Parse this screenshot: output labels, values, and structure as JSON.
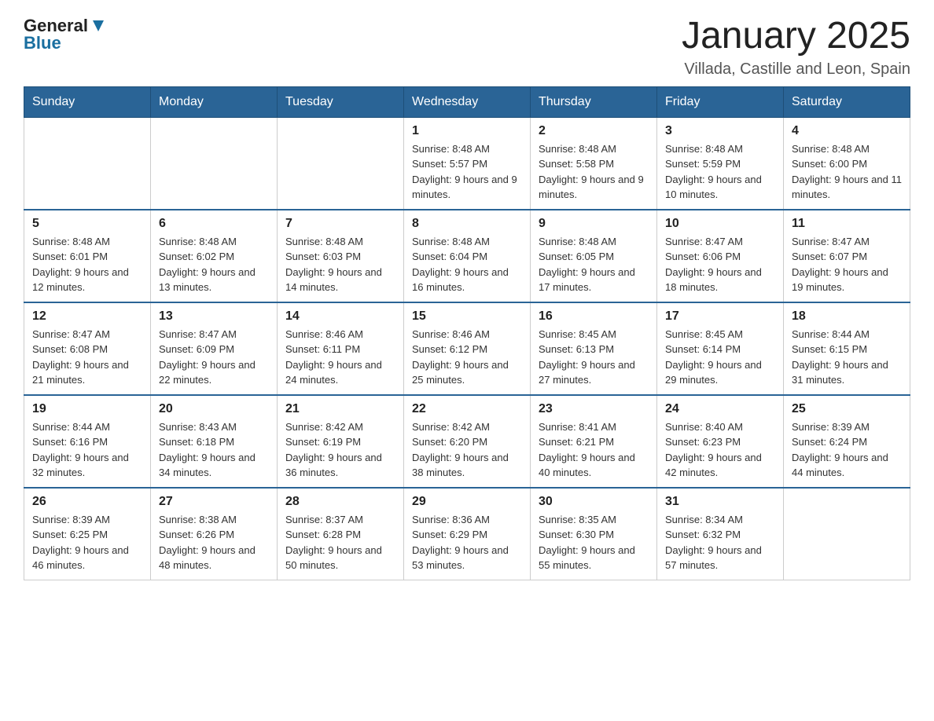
{
  "header": {
    "logo_general": "General",
    "logo_blue": "Blue",
    "title": "January 2025",
    "subtitle": "Villada, Castille and Leon, Spain"
  },
  "weekdays": [
    "Sunday",
    "Monday",
    "Tuesday",
    "Wednesday",
    "Thursday",
    "Friday",
    "Saturday"
  ],
  "weeks": [
    [
      {
        "day": "",
        "info": ""
      },
      {
        "day": "",
        "info": ""
      },
      {
        "day": "",
        "info": ""
      },
      {
        "day": "1",
        "info": "Sunrise: 8:48 AM\nSunset: 5:57 PM\nDaylight: 9 hours and 9 minutes."
      },
      {
        "day": "2",
        "info": "Sunrise: 8:48 AM\nSunset: 5:58 PM\nDaylight: 9 hours and 9 minutes."
      },
      {
        "day": "3",
        "info": "Sunrise: 8:48 AM\nSunset: 5:59 PM\nDaylight: 9 hours and 10 minutes."
      },
      {
        "day": "4",
        "info": "Sunrise: 8:48 AM\nSunset: 6:00 PM\nDaylight: 9 hours and 11 minutes."
      }
    ],
    [
      {
        "day": "5",
        "info": "Sunrise: 8:48 AM\nSunset: 6:01 PM\nDaylight: 9 hours and 12 minutes."
      },
      {
        "day": "6",
        "info": "Sunrise: 8:48 AM\nSunset: 6:02 PM\nDaylight: 9 hours and 13 minutes."
      },
      {
        "day": "7",
        "info": "Sunrise: 8:48 AM\nSunset: 6:03 PM\nDaylight: 9 hours and 14 minutes."
      },
      {
        "day": "8",
        "info": "Sunrise: 8:48 AM\nSunset: 6:04 PM\nDaylight: 9 hours and 16 minutes."
      },
      {
        "day": "9",
        "info": "Sunrise: 8:48 AM\nSunset: 6:05 PM\nDaylight: 9 hours and 17 minutes."
      },
      {
        "day": "10",
        "info": "Sunrise: 8:47 AM\nSunset: 6:06 PM\nDaylight: 9 hours and 18 minutes."
      },
      {
        "day": "11",
        "info": "Sunrise: 8:47 AM\nSunset: 6:07 PM\nDaylight: 9 hours and 19 minutes."
      }
    ],
    [
      {
        "day": "12",
        "info": "Sunrise: 8:47 AM\nSunset: 6:08 PM\nDaylight: 9 hours and 21 minutes."
      },
      {
        "day": "13",
        "info": "Sunrise: 8:47 AM\nSunset: 6:09 PM\nDaylight: 9 hours and 22 minutes."
      },
      {
        "day": "14",
        "info": "Sunrise: 8:46 AM\nSunset: 6:11 PM\nDaylight: 9 hours and 24 minutes."
      },
      {
        "day": "15",
        "info": "Sunrise: 8:46 AM\nSunset: 6:12 PM\nDaylight: 9 hours and 25 minutes."
      },
      {
        "day": "16",
        "info": "Sunrise: 8:45 AM\nSunset: 6:13 PM\nDaylight: 9 hours and 27 minutes."
      },
      {
        "day": "17",
        "info": "Sunrise: 8:45 AM\nSunset: 6:14 PM\nDaylight: 9 hours and 29 minutes."
      },
      {
        "day": "18",
        "info": "Sunrise: 8:44 AM\nSunset: 6:15 PM\nDaylight: 9 hours and 31 minutes."
      }
    ],
    [
      {
        "day": "19",
        "info": "Sunrise: 8:44 AM\nSunset: 6:16 PM\nDaylight: 9 hours and 32 minutes."
      },
      {
        "day": "20",
        "info": "Sunrise: 8:43 AM\nSunset: 6:18 PM\nDaylight: 9 hours and 34 minutes."
      },
      {
        "day": "21",
        "info": "Sunrise: 8:42 AM\nSunset: 6:19 PM\nDaylight: 9 hours and 36 minutes."
      },
      {
        "day": "22",
        "info": "Sunrise: 8:42 AM\nSunset: 6:20 PM\nDaylight: 9 hours and 38 minutes."
      },
      {
        "day": "23",
        "info": "Sunrise: 8:41 AM\nSunset: 6:21 PM\nDaylight: 9 hours and 40 minutes."
      },
      {
        "day": "24",
        "info": "Sunrise: 8:40 AM\nSunset: 6:23 PM\nDaylight: 9 hours and 42 minutes."
      },
      {
        "day": "25",
        "info": "Sunrise: 8:39 AM\nSunset: 6:24 PM\nDaylight: 9 hours and 44 minutes."
      }
    ],
    [
      {
        "day": "26",
        "info": "Sunrise: 8:39 AM\nSunset: 6:25 PM\nDaylight: 9 hours and 46 minutes."
      },
      {
        "day": "27",
        "info": "Sunrise: 8:38 AM\nSunset: 6:26 PM\nDaylight: 9 hours and 48 minutes."
      },
      {
        "day": "28",
        "info": "Sunrise: 8:37 AM\nSunset: 6:28 PM\nDaylight: 9 hours and 50 minutes."
      },
      {
        "day": "29",
        "info": "Sunrise: 8:36 AM\nSunset: 6:29 PM\nDaylight: 9 hours and 53 minutes."
      },
      {
        "day": "30",
        "info": "Sunrise: 8:35 AM\nSunset: 6:30 PM\nDaylight: 9 hours and 55 minutes."
      },
      {
        "day": "31",
        "info": "Sunrise: 8:34 AM\nSunset: 6:32 PM\nDaylight: 9 hours and 57 minutes."
      },
      {
        "day": "",
        "info": ""
      }
    ]
  ]
}
